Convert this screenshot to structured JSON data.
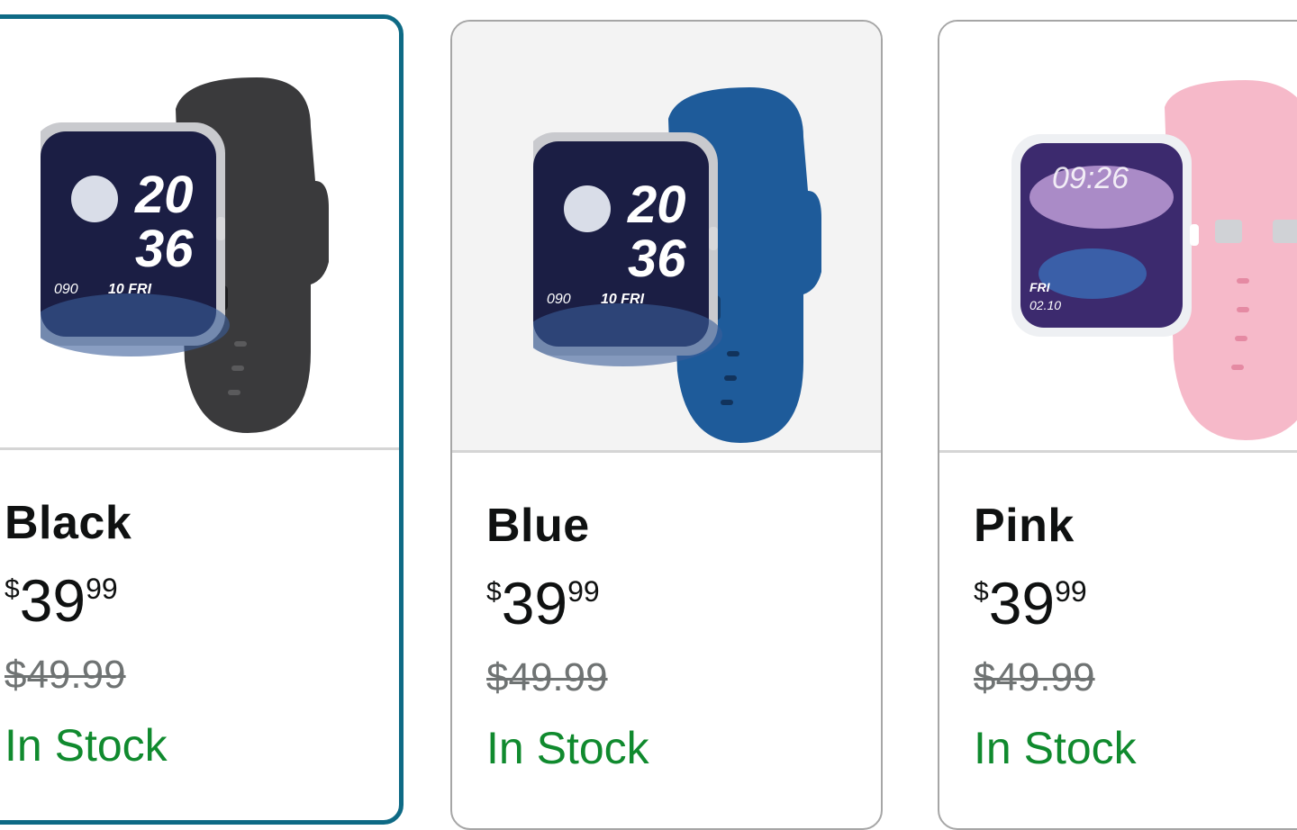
{
  "variants": [
    {
      "name": "Black",
      "price_symbol": "$",
      "price_whole": "39",
      "price_fraction": "99",
      "list_price": "$49.99",
      "availability": "In Stock",
      "band_color": "#3a3a3c",
      "face": {
        "line1": "20",
        "line2": "36",
        "small_left": "090",
        "small_right": "10 FRI"
      }
    },
    {
      "name": "Blue",
      "price_symbol": "$",
      "price_whole": "39",
      "price_fraction": "99",
      "list_price": "$49.99",
      "availability": "In Stock",
      "band_color": "#1e5b9a",
      "face": {
        "line1": "20",
        "line2": "36",
        "small_left": "090",
        "small_right": "10 FRI"
      }
    },
    {
      "name": "Pink",
      "price_symbol": "$",
      "price_whole": "39",
      "price_fraction": "99",
      "list_price": "$49.99",
      "availability": "In Stock",
      "band_color": "#f6b9c9",
      "face": {
        "line1": "09:26",
        "small_left": "FRI",
        "small_right": "02.10"
      }
    }
  ],
  "selected_variant": "Black",
  "colors": {
    "selected_border": "#0e6a85",
    "in_stock": "#108a2e",
    "strike_price": "#6f7373"
  }
}
